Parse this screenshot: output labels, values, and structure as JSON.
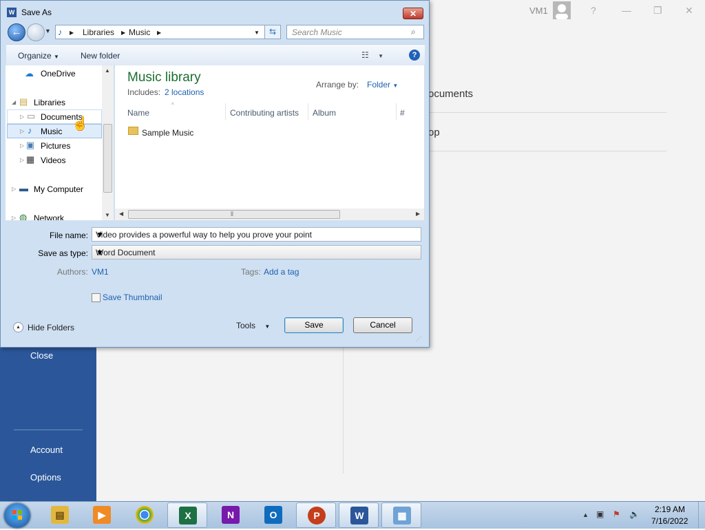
{
  "backstage": {
    "menu": {
      "close": "Close",
      "account": "Account",
      "options": "Options"
    },
    "right_items": [
      "ocuments",
      "op"
    ],
    "user": "VM1",
    "window_controls": {
      "help": "?",
      "minimize": "—",
      "restore": "❐",
      "close": "✕"
    }
  },
  "dialog": {
    "title": "Save As",
    "address": {
      "crumbs": [
        "Libraries",
        "Music"
      ]
    },
    "search": {
      "placeholder": "Search Music"
    },
    "toolbar": {
      "organize": "Organize",
      "new_folder": "New folder"
    },
    "nav": {
      "onedrive": "OneDrive",
      "libraries": "Libraries",
      "documents": "Documents",
      "music": "Music",
      "pictures": "Pictures",
      "videos": "Videos",
      "my_computer": "My Computer",
      "network": "Network"
    },
    "library": {
      "title": "Music library",
      "includes_label": "Includes:",
      "includes_link": "2 locations",
      "arrange_label": "Arrange by:",
      "arrange_value": "Folder"
    },
    "columns": [
      "Name",
      "Contributing artists",
      "Album",
      "#"
    ],
    "items": [
      {
        "name": "Sample Music"
      }
    ],
    "form": {
      "file_name_label": "File name:",
      "file_name_value": "Video provides a powerful way to help you prove your point",
      "save_type_label": "Save as type:",
      "save_type_value": "Word Document",
      "authors_label": "Authors:",
      "authors_value": "VM1",
      "tags_label": "Tags:",
      "tags_value": "Add a tag",
      "thumbnail_label": "Save Thumbnail",
      "thumbnail_checked": false
    },
    "buttons": {
      "hide_folders": "Hide Folders",
      "tools": "Tools",
      "save": "Save",
      "cancel": "Cancel"
    }
  },
  "taskbar": {
    "apps": [
      {
        "name": "File Explorer",
        "active": false
      },
      {
        "name": "Media Player",
        "active": false
      },
      {
        "name": "Chrome",
        "active": false
      },
      {
        "name": "Excel",
        "active": true
      },
      {
        "name": "OneNote",
        "active": false
      },
      {
        "name": "Outlook",
        "active": false
      },
      {
        "name": "PowerPoint",
        "active": true
      },
      {
        "name": "Word",
        "active": true
      },
      {
        "name": "Control Panel",
        "active": true
      }
    ],
    "time": "2:19 AM",
    "date": "7/16/2022"
  },
  "colors": {
    "word_blue": "#2b579a",
    "link": "#1d61b0",
    "library_title": "#1a6e2e"
  }
}
